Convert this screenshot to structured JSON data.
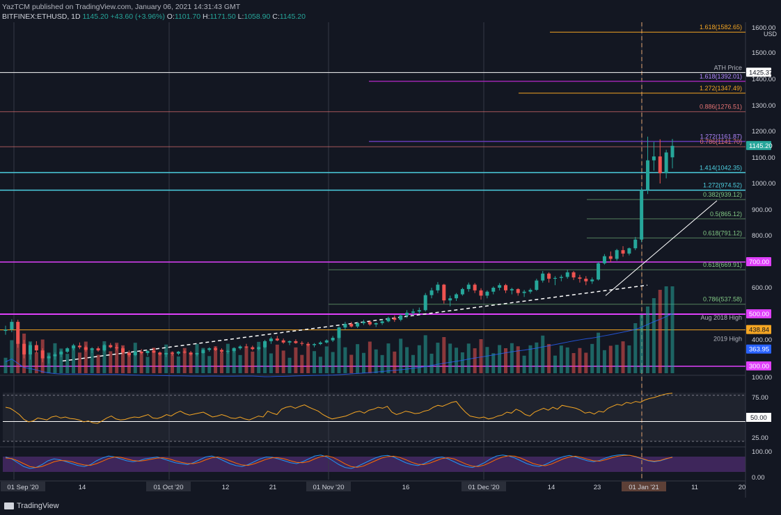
{
  "header": {
    "publisher": "YazTCM published on TradingView.com, January 06, 2021 14:31:43 GMT",
    "symbol": "BITFINEX:ETHUSD, 1D",
    "last": "1145.20",
    "change": "+43.60 (+3.96%)",
    "o_label": "O:",
    "o": "1101.70",
    "h_label": "H:",
    "h": "1171.50",
    "l_label": "L:",
    "l": "1058.90",
    "c_label": "C:",
    "c": "1145.20"
  },
  "footer": {
    "brand": "TradingView"
  },
  "colors": {
    "bg": "#131722",
    "up": "#26a69a",
    "down": "#ef5350",
    "magenta": "#e040fb",
    "cyan": "#4dd0e1",
    "orange": "#f5a623",
    "green_fib": "#81c784",
    "salmon": "#e57373",
    "purple": "#7e57c2",
    "white": "#ffffff",
    "rsi": "#f5a623"
  },
  "chart_data": {
    "type": "candlestick",
    "symbol": "BITFINEX:ETHUSD",
    "interval": "1D",
    "currency": "USD",
    "price_ticks": [
      "1600.00",
      "1500.00",
      "1400.00",
      "1300.00",
      "1200.00",
      "1100.00",
      "1000.00",
      "900.00",
      "800.00",
      "600.00",
      "400.00",
      "100.00"
    ],
    "x_ticks": [
      "01 Sep '20",
      "14",
      "01 Oct '20",
      "12",
      "21",
      "01 Nov '20",
      "16",
      "01 Dec '20",
      "14",
      "23",
      "01 Jan '21",
      "11",
      "20"
    ],
    "ylim": [
      300,
      1610
    ],
    "level_labels": [
      {
        "text": "1.618(1582.65)",
        "price": 1582.65,
        "color": "#f5a623"
      },
      {
        "text": "ATH Price",
        "price": 1425.37,
        "color": "#b2b5be"
      },
      {
        "text": "1.618(1392.01)",
        "price": 1392.01,
        "color": "#b388ff"
      },
      {
        "text": "1.272(1347.49)",
        "price": 1347.49,
        "color": "#f5a623"
      },
      {
        "text": "0.886(1276.51)",
        "price": 1276.51,
        "color": "#e57373"
      },
      {
        "text": "1.272(1161.87)",
        "price": 1161.87,
        "color": "#b388ff"
      },
      {
        "text": "0.786(1141.70)",
        "price": 1141.7,
        "color": "#e57373"
      },
      {
        "text": "1.414(1042.35)",
        "price": 1042.35,
        "color": "#4dd0e1"
      },
      {
        "text": "1.272(974.52)",
        "price": 974.52,
        "color": "#4dd0e1"
      },
      {
        "text": "0.382(939.12)",
        "price": 939.12,
        "color": "#81c784"
      },
      {
        "text": "0.5(865.12)",
        "price": 865.12,
        "color": "#81c784"
      },
      {
        "text": "0.618(791.12)",
        "price": 791.12,
        "color": "#81c784"
      },
      {
        "text": "0.618(669.91)",
        "price": 669.91,
        "color": "#81c784"
      },
      {
        "text": "0.786(537.58)",
        "price": 537.58,
        "color": "#81c784"
      },
      {
        "text": "Aug 2018 High",
        "price": 468,
        "color": "#b2b5be"
      },
      {
        "text": "2019 High",
        "price": 385,
        "color": "#b2b5be"
      }
    ],
    "price_tags": [
      {
        "text": "1425.37",
        "price": 1425.37,
        "bg": "#ffffff",
        "fg": "#131722"
      },
      {
        "text": "1145.20",
        "price": 1145.2,
        "bg": "#26a69a",
        "fg": "#ffffff"
      },
      {
        "text": "700.00",
        "price": 700,
        "bg": "#e040fb",
        "fg": "#ffffff"
      },
      {
        "text": "500.00",
        "price": 500,
        "bg": "#e040fb",
        "fg": "#ffffff"
      },
      {
        "text": "438.84",
        "price": 438.84,
        "bg": "#f5a623",
        "fg": "#131722"
      },
      {
        "text": "363.95",
        "price": 363.95,
        "bg": "#2962ff",
        "fg": "#ffffff"
      },
      {
        "text": "300.00",
        "price": 300,
        "bg": "#e040fb",
        "fg": "#ffffff"
      }
    ],
    "rsi": {
      "ticks": [
        "100.00",
        "75.00",
        "25.00"
      ],
      "tag": "50.00",
      "series": [
        70,
        68,
        62,
        55,
        45,
        40,
        42,
        48,
        46,
        44,
        50,
        52,
        48,
        50,
        47,
        46,
        44,
        40,
        42,
        38,
        37,
        42,
        48,
        52,
        46,
        44,
        45,
        48,
        50,
        49,
        52,
        55,
        48,
        47,
        50,
        55,
        52,
        58,
        62,
        57,
        54,
        56,
        58,
        60,
        55,
        50,
        52,
        55,
        52,
        48,
        47,
        50,
        46,
        44,
        48,
        52,
        50,
        62,
        58,
        55,
        66,
        70,
        72,
        68,
        72,
        75,
        70,
        66,
        62,
        55,
        50,
        46,
        48,
        50,
        52,
        56,
        60,
        62,
        58,
        64,
        66,
        70,
        68,
        72,
        60,
        55,
        58,
        62,
        60,
        57,
        58,
        62,
        64,
        70,
        74,
        72,
        76,
        80,
        82,
        70,
        60,
        52,
        50,
        48,
        50,
        46,
        48,
        52,
        54,
        60,
        58,
        66,
        62,
        55,
        52,
        60,
        64,
        68,
        64,
        70,
        66,
        74,
        72,
        70,
        68,
        64,
        58,
        60,
        56,
        62,
        60,
        68,
        72,
        76,
        74,
        80,
        78,
        82,
        80,
        85,
        88,
        90,
        93,
        96,
        98,
        99
      ]
    },
    "stoch": {
      "ticks": [
        "100.00",
        "0.00"
      ],
      "k": [
        80,
        70,
        50,
        30,
        20,
        25,
        40,
        60,
        70,
        65,
        55,
        45,
        35,
        30,
        40,
        60,
        75,
        85,
        80,
        70,
        60,
        55,
        60,
        70,
        75,
        80,
        70,
        60,
        50,
        45,
        40,
        50,
        65,
        80,
        85,
        75,
        60,
        45,
        35,
        30,
        40,
        55,
        70,
        80,
        78,
        70,
        60,
        50,
        45,
        55,
        70,
        85,
        90,
        80,
        60,
        40,
        25,
        20,
        30,
        45,
        60,
        75,
        85,
        88,
        80,
        65,
        50,
        40,
        35,
        45,
        60,
        75,
        80,
        70,
        55,
        40,
        30,
        25,
        35,
        50,
        70,
        85,
        90,
        85,
        75,
        60,
        45,
        35,
        30,
        40,
        55,
        70,
        82,
        88,
        80,
        70,
        60,
        55,
        62,
        75,
        85,
        90,
        92,
        88,
        80,
        70,
        60,
        55,
        60,
        70,
        80
      ],
      "d": [
        75,
        72,
        60,
        45,
        30,
        25,
        30,
        42,
        55,
        62,
        60,
        55,
        45,
        38,
        36,
        45,
        58,
        72,
        80,
        78,
        70,
        62,
        58,
        62,
        68,
        74,
        76,
        70,
        60,
        52,
        46,
        45,
        52,
        65,
        76,
        80,
        72,
        60,
        48,
        38,
        36,
        44,
        56,
        68,
        76,
        76,
        70,
        60,
        52,
        50,
        56,
        70,
        82,
        86,
        78,
        62,
        44,
        30,
        26,
        32,
        46,
        60,
        74,
        82,
        84,
        78,
        66,
        52,
        42,
        40,
        48,
        60,
        72,
        76,
        70,
        56,
        42,
        32,
        30,
        38,
        52,
        68,
        80,
        86,
        84,
        74,
        60,
        46,
        38,
        34,
        42,
        56,
        70,
        80,
        84,
        78,
        68,
        60,
        58,
        66,
        76,
        84,
        88,
        88,
        82,
        72,
        62,
        58,
        62,
        72,
        78
      ]
    },
    "series": [
      {
        "name": "ETHUSD",
        "ohlc": [
          [
            435,
            455,
            420,
            440
          ],
          [
            440,
            480,
            430,
            470
          ],
          [
            470,
            478,
            370,
            385
          ],
          [
            385,
            400,
            330,
            345
          ],
          [
            345,
            390,
            325,
            380
          ],
          [
            380,
            395,
            350,
            360
          ],
          [
            360,
            368,
            315,
            330
          ],
          [
            330,
            345,
            310,
            338
          ],
          [
            338,
            352,
            325,
            345
          ],
          [
            345,
            360,
            335,
            355
          ],
          [
            355,
            372,
            350,
            368
          ],
          [
            368,
            385,
            360,
            378
          ],
          [
            378,
            390,
            365,
            372
          ],
          [
            372,
            378,
            355,
            362
          ],
          [
            362,
            372,
            350,
            368
          ],
          [
            368,
            375,
            355,
            360
          ],
          [
            360,
            385,
            355,
            380
          ],
          [
            380,
            388,
            368,
            372
          ],
          [
            372,
            382,
            360,
            368
          ],
          [
            368,
            375,
            345,
            352
          ],
          [
            352,
            360,
            335,
            342
          ],
          [
            342,
            358,
            338,
            355
          ],
          [
            355,
            365,
            345,
            350
          ],
          [
            350,
            362,
            340,
            358
          ],
          [
            358,
            368,
            350,
            352
          ],
          [
            352,
            356,
            340,
            345
          ],
          [
            345,
            352,
            335,
            350
          ],
          [
            350,
            356,
            340,
            348
          ],
          [
            348,
            358,
            342,
            355
          ],
          [
            355,
            362,
            348,
            352
          ],
          [
            352,
            358,
            340,
            345
          ],
          [
            345,
            352,
            338,
            350
          ],
          [
            350,
            365,
            348,
            362
          ],
          [
            362,
            372,
            355,
            368
          ],
          [
            368,
            375,
            358,
            362
          ],
          [
            362,
            368,
            350,
            355
          ],
          [
            355,
            362,
            348,
            358
          ],
          [
            358,
            372,
            352,
            368
          ],
          [
            368,
            380,
            362,
            375
          ],
          [
            375,
            385,
            368,
            372
          ],
          [
            372,
            378,
            360,
            365
          ],
          [
            365,
            375,
            360,
            372
          ],
          [
            372,
            400,
            368,
            395
          ],
          [
            395,
            412,
            385,
            405
          ],
          [
            405,
            415,
            395,
            398
          ],
          [
            398,
            405,
            385,
            390
          ],
          [
            390,
            398,
            380,
            395
          ],
          [
            395,
            402,
            385,
            388
          ],
          [
            388,
            395,
            378,
            385
          ],
          [
            385,
            392,
            375,
            380
          ],
          [
            380,
            388,
            372,
            384
          ],
          [
            384,
            395,
            380,
            390
          ],
          [
            390,
            402,
            386,
            398
          ],
          [
            398,
            415,
            392,
            408
          ],
          [
            408,
            452,
            404,
            448
          ],
          [
            448,
            470,
            440,
            462
          ],
          [
            462,
            470,
            448,
            452
          ],
          [
            452,
            468,
            446,
            465
          ],
          [
            465,
            478,
            458,
            470
          ],
          [
            470,
            475,
            455,
            460
          ],
          [
            460,
            468,
            450,
            465
          ],
          [
            465,
            480,
            458,
            472
          ],
          [
            472,
            490,
            468,
            485
          ],
          [
            485,
            495,
            470,
            478
          ],
          [
            478,
            500,
            472,
            495
          ],
          [
            495,
            515,
            485,
            505
          ],
          [
            505,
            520,
            495,
            510
          ],
          [
            510,
            525,
            500,
            515
          ],
          [
            515,
            580,
            510,
            572
          ],
          [
            572,
            600,
            560,
            590
          ],
          [
            590,
            622,
            580,
            612
          ],
          [
            612,
            615,
            540,
            552
          ],
          [
            552,
            570,
            530,
            560
          ],
          [
            560,
            580,
            550,
            575
          ],
          [
            575,
            600,
            570,
            595
          ],
          [
            595,
            620,
            585,
            612
          ],
          [
            612,
            618,
            580,
            590
          ],
          [
            590,
            598,
            555,
            570
          ],
          [
            570,
            590,
            560,
            585
          ],
          [
            585,
            605,
            575,
            600
          ],
          [
            600,
            618,
            590,
            610
          ],
          [
            610,
            615,
            580,
            590
          ],
          [
            590,
            600,
            575,
            595
          ],
          [
            595,
            598,
            570,
            580
          ],
          [
            580,
            592,
            565,
            585
          ],
          [
            585,
            598,
            578,
            592
          ],
          [
            592,
            635,
            588,
            628
          ],
          [
            628,
            665,
            620,
            655
          ],
          [
            655,
            660,
            620,
            635
          ],
          [
            635,
            645,
            610,
            638
          ],
          [
            638,
            650,
            625,
            642
          ],
          [
            642,
            670,
            635,
            660
          ],
          [
            660,
            665,
            630,
            640
          ],
          [
            640,
            650,
            620,
            635
          ],
          [
            635,
            645,
            610,
            625
          ],
          [
            625,
            640,
            615,
            632
          ],
          [
            632,
            700,
            628,
            695
          ],
          [
            695,
            730,
            690,
            722
          ],
          [
            722,
            740,
            700,
            712
          ],
          [
            712,
            750,
            705,
            745
          ],
          [
            745,
            760,
            720,
            732
          ],
          [
            732,
            755,
            725,
            752
          ],
          [
            752,
            795,
            745,
            785
          ],
          [
            785,
            985,
            775,
            975
          ],
          [
            975,
            1180,
            960,
            1090
          ],
          [
            1090,
            1160,
            1050,
            1105
          ],
          [
            1105,
            1170,
            1000,
            1040
          ],
          [
            1040,
            1130,
            1020,
            1120
          ],
          [
            1101.7,
            1171.5,
            1058.9,
            1145.2
          ]
        ]
      }
    ]
  }
}
